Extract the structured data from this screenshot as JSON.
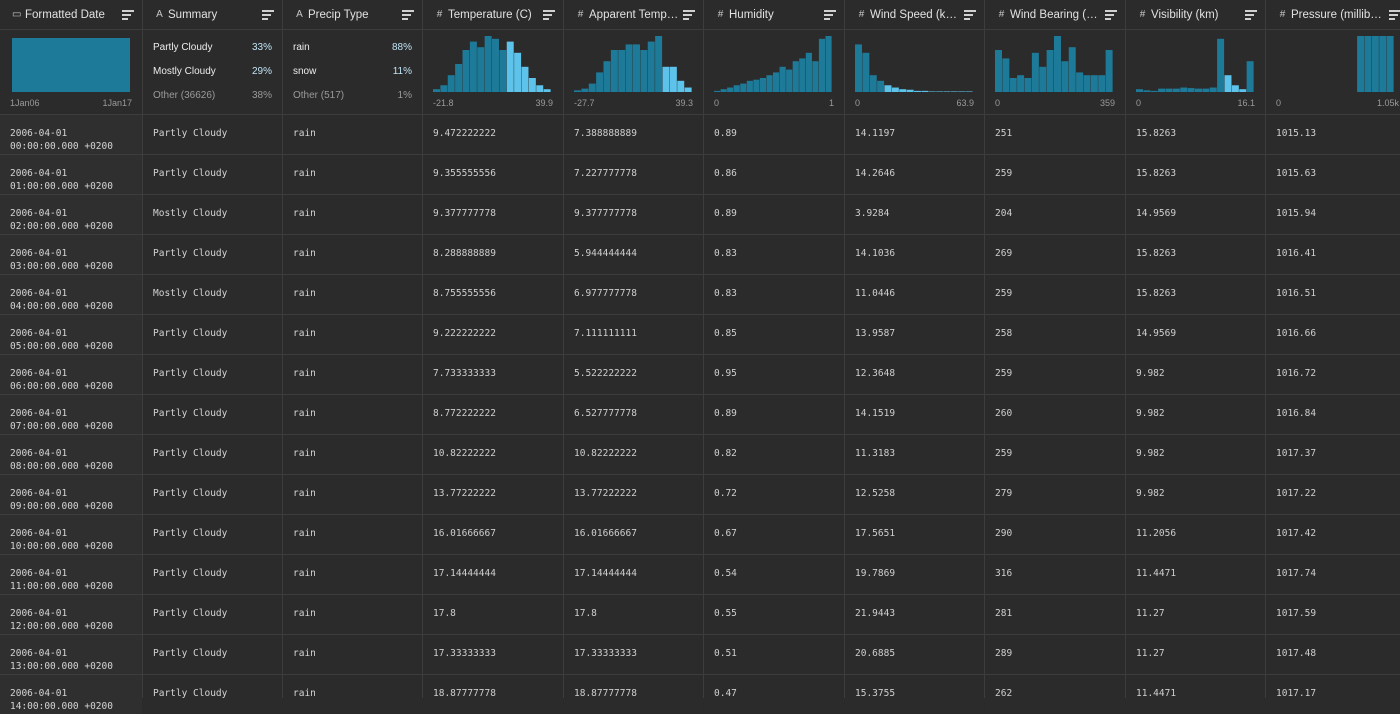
{
  "columns": [
    {
      "name": "Formatted Date",
      "type_icon": "calendar-icon",
      "type_glyph": "▭"
    },
    {
      "name": "Summary",
      "type_icon": "text-type-icon",
      "type_glyph": "A"
    },
    {
      "name": "Precip Type",
      "type_icon": "text-type-icon",
      "type_glyph": "A"
    },
    {
      "name": "Temperature (C)",
      "type_icon": "number-type-icon",
      "type_glyph": "#"
    },
    {
      "name": "Apparent Temperature (C)",
      "type_icon": "number-type-icon",
      "type_glyph": "#"
    },
    {
      "name": "Humidity",
      "type_icon": "number-type-icon",
      "type_glyph": "#"
    },
    {
      "name": "Wind Speed (km/h)",
      "type_icon": "number-type-icon",
      "type_glyph": "#"
    },
    {
      "name": "Wind Bearing (degrees)",
      "type_icon": "number-type-icon",
      "type_glyph": "#"
    },
    {
      "name": "Visibility (km)",
      "type_icon": "number-type-icon",
      "type_glyph": "#"
    },
    {
      "name": "Pressure (millibars)",
      "type_icon": "number-type-icon",
      "type_glyph": "#"
    }
  ],
  "summaries": {
    "formatted_date": {
      "min": "1Jan06",
      "max": "1Jan17"
    },
    "summary": {
      "cats": [
        {
          "label": "Partly Cloudy",
          "pct": "33%"
        },
        {
          "label": "Mostly Cloudy",
          "pct": "29%"
        },
        {
          "label": "Other (36626)",
          "pct": "38%"
        }
      ]
    },
    "precip_type": {
      "cats": [
        {
          "label": "rain",
          "pct": "88%"
        },
        {
          "label": "snow",
          "pct": "11%"
        },
        {
          "label": "Other (517)",
          "pct": "1%"
        }
      ]
    },
    "temperature": {
      "min": "-21.8",
      "max": "39.9",
      "bins": [
        0.05,
        0.12,
        0.3,
        0.5,
        0.75,
        0.9,
        0.8,
        1.0,
        0.95,
        0.75,
        0.9,
        0.7,
        0.45,
        0.25,
        0.12,
        0.05
      ],
      "hi": [
        10,
        11,
        12,
        13,
        14,
        15
      ]
    },
    "apparent_temperature": {
      "min": "-27.7",
      "max": "39.3",
      "bins": [
        0.03,
        0.06,
        0.15,
        0.35,
        0.55,
        0.75,
        0.75,
        0.85,
        0.85,
        0.75,
        0.9,
        1.0,
        0.45,
        0.45,
        0.2,
        0.08
      ],
      "hi": [
        12,
        13,
        14,
        15
      ]
    },
    "humidity": {
      "min": "0",
      "max": "1",
      "bins": [
        0.02,
        0.05,
        0.08,
        0.12,
        0.15,
        0.2,
        0.22,
        0.25,
        0.3,
        0.35,
        0.45,
        0.4,
        0.55,
        0.6,
        0.7,
        0.55,
        0.95,
        1.0
      ],
      "hi": []
    },
    "wind_speed": {
      "min": "0",
      "max": "63.9",
      "bins": [
        0.85,
        0.7,
        0.3,
        0.2,
        0.12,
        0.08,
        0.05,
        0.04,
        0.02,
        0.02,
        0.01,
        0.01,
        0.01,
        0.01,
        0.01,
        0.01
      ],
      "hi": [
        4,
        5,
        6,
        7,
        8,
        9,
        10,
        11,
        12,
        13,
        14,
        15
      ]
    },
    "wind_bearing": {
      "min": "0",
      "max": "359",
      "bins": [
        0.75,
        0.6,
        0.25,
        0.3,
        0.25,
        0.7,
        0.45,
        0.75,
        1.0,
        0.55,
        0.8,
        0.35,
        0.3,
        0.3,
        0.3,
        0.75
      ],
      "hi": []
    },
    "visibility": {
      "min": "0",
      "max": "16.1",
      "bins": [
        0.05,
        0.03,
        0.02,
        0.06,
        0.06,
        0.06,
        0.08,
        0.07,
        0.06,
        0.06,
        0.08,
        0.95,
        0.3,
        0.12,
        0.05,
        0.55
      ],
      "hi": [
        12,
        13,
        14
      ]
    },
    "pressure": {
      "min": "0",
      "max": "1.05k",
      "bins": [
        0,
        0,
        0,
        0,
        0,
        0,
        0,
        0,
        0,
        0,
        0,
        1.0,
        1.0,
        1.0,
        1.0,
        1.0
      ],
      "hi": []
    }
  },
  "rows": [
    [
      "2006-04-01 00:00:00.000 +0200",
      "Partly Cloudy",
      "rain",
      "9.472222222",
      "7.388888889",
      "0.89",
      "14.1197",
      "251",
      "15.8263",
      "1015.13"
    ],
    [
      "2006-04-01 01:00:00.000 +0200",
      "Partly Cloudy",
      "rain",
      "9.355555556",
      "7.227777778",
      "0.86",
      "14.2646",
      "259",
      "15.8263",
      "1015.63"
    ],
    [
      "2006-04-01 02:00:00.000 +0200",
      "Mostly Cloudy",
      "rain",
      "9.377777778",
      "9.377777778",
      "0.89",
      "3.9284",
      "204",
      "14.9569",
      "1015.94"
    ],
    [
      "2006-04-01 03:00:00.000 +0200",
      "Partly Cloudy",
      "rain",
      "8.288888889",
      "5.944444444",
      "0.83",
      "14.1036",
      "269",
      "15.8263",
      "1016.41"
    ],
    [
      "2006-04-01 04:00:00.000 +0200",
      "Mostly Cloudy",
      "rain",
      "8.755555556",
      "6.977777778",
      "0.83",
      "11.0446",
      "259",
      "15.8263",
      "1016.51"
    ],
    [
      "2006-04-01 05:00:00.000 +0200",
      "Partly Cloudy",
      "rain",
      "9.222222222",
      "7.111111111",
      "0.85",
      "13.9587",
      "258",
      "14.9569",
      "1016.66"
    ],
    [
      "2006-04-01 06:00:00.000 +0200",
      "Partly Cloudy",
      "rain",
      "7.733333333",
      "5.522222222",
      "0.95",
      "12.3648",
      "259",
      "9.982",
      "1016.72"
    ],
    [
      "2006-04-01 07:00:00.000 +0200",
      "Partly Cloudy",
      "rain",
      "8.772222222",
      "6.527777778",
      "0.89",
      "14.1519",
      "260",
      "9.982",
      "1016.84"
    ],
    [
      "2006-04-01 08:00:00.000 +0200",
      "Partly Cloudy",
      "rain",
      "10.82222222",
      "10.82222222",
      "0.82",
      "11.3183",
      "259",
      "9.982",
      "1017.37"
    ],
    [
      "2006-04-01 09:00:00.000 +0200",
      "Partly Cloudy",
      "rain",
      "13.77222222",
      "13.77222222",
      "0.72",
      "12.5258",
      "279",
      "9.982",
      "1017.22"
    ],
    [
      "2006-04-01 10:00:00.000 +0200",
      "Partly Cloudy",
      "rain",
      "16.01666667",
      "16.01666667",
      "0.67",
      "17.5651",
      "290",
      "11.2056",
      "1017.42"
    ],
    [
      "2006-04-01 11:00:00.000 +0200",
      "Partly Cloudy",
      "rain",
      "17.14444444",
      "17.14444444",
      "0.54",
      "19.7869",
      "316",
      "11.4471",
      "1017.74"
    ],
    [
      "2006-04-01 12:00:00.000 +0200",
      "Partly Cloudy",
      "rain",
      "17.8",
      "17.8",
      "0.55",
      "21.9443",
      "281",
      "11.27",
      "1017.59"
    ],
    [
      "2006-04-01 13:00:00.000 +0200",
      "Partly Cloudy",
      "rain",
      "17.33333333",
      "17.33333333",
      "0.51",
      "20.6885",
      "289",
      "11.27",
      "1017.48"
    ],
    [
      "2006-04-01 14:00:00.000 +0200",
      "Partly Cloudy",
      "rain",
      "18.87777778",
      "18.87777778",
      "0.47",
      "15.3755",
      "262",
      "11.4471",
      "1017.17"
    ]
  ],
  "colors": {
    "bar": "#1e7a99",
    "bar_highlight": "#5ec3ea",
    "date_fill": "#1e7a99"
  }
}
